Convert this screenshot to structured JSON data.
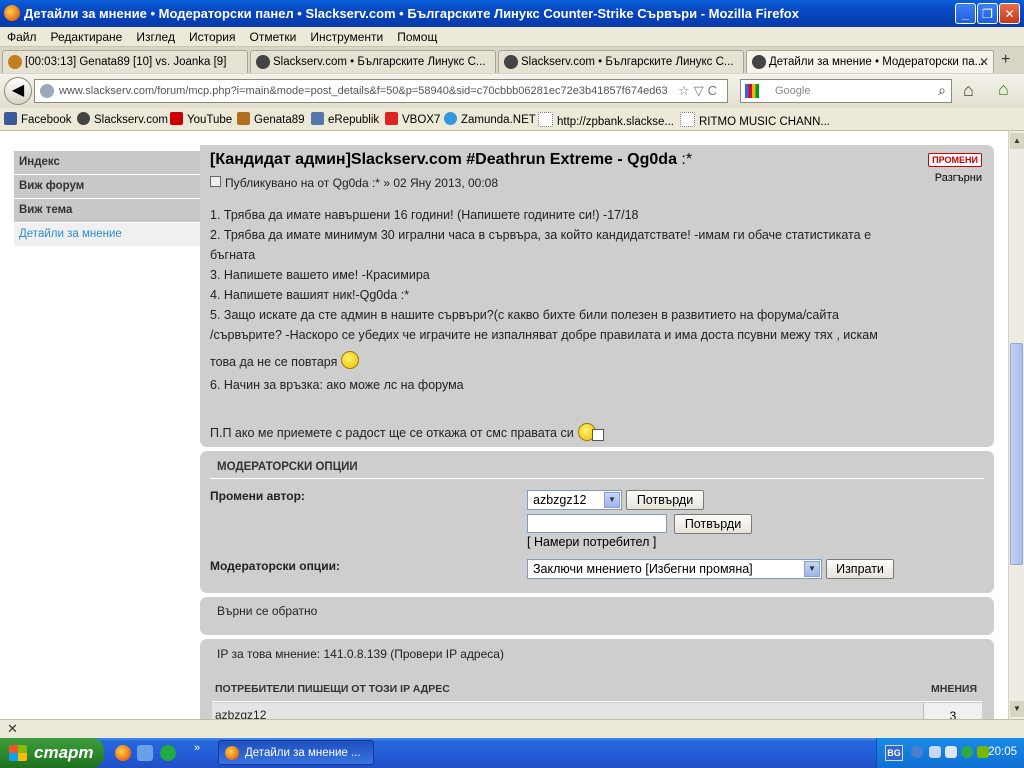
{
  "window": {
    "title": "Детайли за мнение • Модераторски панел • Slackserv.com • Българските Линукс Counter-Strike Сървъри - Mozilla Firefox"
  },
  "menu": [
    "Файл",
    "Редактиране",
    "Изглед",
    "История",
    "Отметки",
    "Инструменти",
    "Помощ"
  ],
  "tabs": [
    {
      "label": "[00:03:13] Genata89 [10] vs. Joanka [9]"
    },
    {
      "label": "Slackserv.com • Българските Линукс C..."
    },
    {
      "label": "Slackserv.com • Българските Линукс C..."
    },
    {
      "label": "Детайли за мнение • Модераторски па...",
      "active": true
    }
  ],
  "nav": {
    "url": "www.slackserv.com/forum/mcp.php?i=main&mode=post_details&f=50&p=58940&sid=c70cbbb06281ec72e3b41857f674ed63",
    "search_placeholder": "Google"
  },
  "bookmarks": [
    {
      "label": "Facebook",
      "color": "#3b5998"
    },
    {
      "label": "Slackserv.com",
      "color": "#444444"
    },
    {
      "label": "YouTube",
      "color": "#cc0000"
    },
    {
      "label": "Genata89",
      "color": "#b07020"
    },
    {
      "label": "eRepublik",
      "color": "#5577aa"
    },
    {
      "label": "VBOX7",
      "color": "#dd2222"
    },
    {
      "label": "Zamunda.NET",
      "color": "#3399dd"
    },
    {
      "label": "http://zpbank.slackse...",
      "color": "#ffffff"
    },
    {
      "label": "RITMO MUSIC CHANN...",
      "color": "#ffffff"
    }
  ],
  "sidemenu": [
    {
      "label": "Индекс"
    },
    {
      "label": "Виж форум"
    },
    {
      "label": "Виж тема"
    },
    {
      "label": "Детайли за мнение",
      "active": true
    }
  ],
  "post": {
    "title": "[Кандидат админ]Slackserv.com #Deathrun Extreme - Qg0da",
    "title_suffix": " :*",
    "meta_prefix": "Публикувано на от ",
    "author": "Qg0da :*",
    "date": " » 02 Яну 2013, 00:08",
    "edit_button": "ПРОМЕНИ",
    "expand": "Разгърни",
    "lines": [
      "1. Трябва да имате навършени 16 години! (Напишете годините си!) -17/18",
      "2. Трябва да имате минимум 30 игрални часа в сървъра, за който кандидатствате! -имам ги обаче статистиката е",
      "бъгната",
      "3. Напишете вашето име! -Красимира",
      "4. Напишете вашият ник!-Qg0da :*",
      "5. Защо искате да сте админ в нашите сървъри?(с какво бихте били полезен в развитието на форума/сайта",
      "/сървърите? -Наскоро се убедих че играчите не изпалняват добре правилата и има доста псувни межу тях , искам",
      "това да не се повтаря",
      "6. Начин за връзка: ако може лс на форума",
      "",
      "П.П ако ме приемете с радост ще се откажа от смс правата си"
    ]
  },
  "moderator": {
    "heading": "МОДЕРАТОРСКИ ОПЦИИ",
    "change_author_label": "Промени автор:",
    "author_select": "azbzgz12",
    "confirm1": "Потвърди",
    "confirm2": "Потвърди",
    "find_user": "[ Намери потребител ]",
    "mod_options_label": "Модераторски опции:",
    "mod_select": "Заключи мнението [Избегни промяна]",
    "send": "Изпрати"
  },
  "goback": "Върни се обратно",
  "ip": {
    "text": "IP за това мнение: 141.0.8.139 (Провери IP адреса)",
    "col_users": "ПОТРЕБИТЕЛИ ПИШЕЩИ ОТ ТОЗИ IP АДРЕС",
    "col_posts": "МНЕНИЯ",
    "rows": [
      {
        "user": "azbzgz12",
        "posts": "3"
      }
    ]
  },
  "taskbar": {
    "start": "старт",
    "task_label": "Детайли за мнение ...",
    "lang": "BG",
    "clock": "20:05"
  }
}
